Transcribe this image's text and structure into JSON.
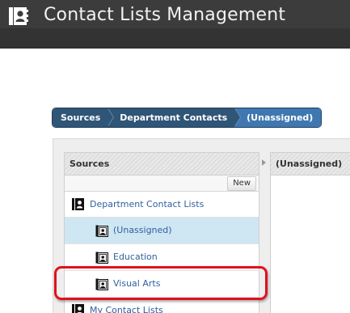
{
  "header": {
    "title": "Contact Lists Management",
    "icon": "contacts-book-icon"
  },
  "breadcrumb": [
    {
      "label": "Sources"
    },
    {
      "label": "Department Contacts"
    },
    {
      "label": "(Unassigned)"
    }
  ],
  "columns": {
    "sources": {
      "header": "Sources",
      "new_button": "New",
      "rows": [
        {
          "label": "Department Contact Lists",
          "icon": "contacts-book-icon"
        },
        {
          "label": "(Unassigned)",
          "icon": "contact-card-icon",
          "selected": true
        },
        {
          "label": "Education",
          "icon": "contact-card-icon"
        },
        {
          "label": "Visual Arts",
          "icon": "contact-card-icon",
          "highlighted": true
        },
        {
          "label": "My Contact Lists",
          "icon": "contacts-book-icon"
        }
      ]
    },
    "detail": {
      "header": "(Unassigned)"
    }
  },
  "colors": {
    "header_bg": "#3c3c3c",
    "breadcrumb_bg": "#2f5577",
    "breadcrumb_current": "#3f78b0",
    "selected_row": "#cfe6f3",
    "link_text": "#2f5fa0",
    "highlight": "#e0121b"
  }
}
